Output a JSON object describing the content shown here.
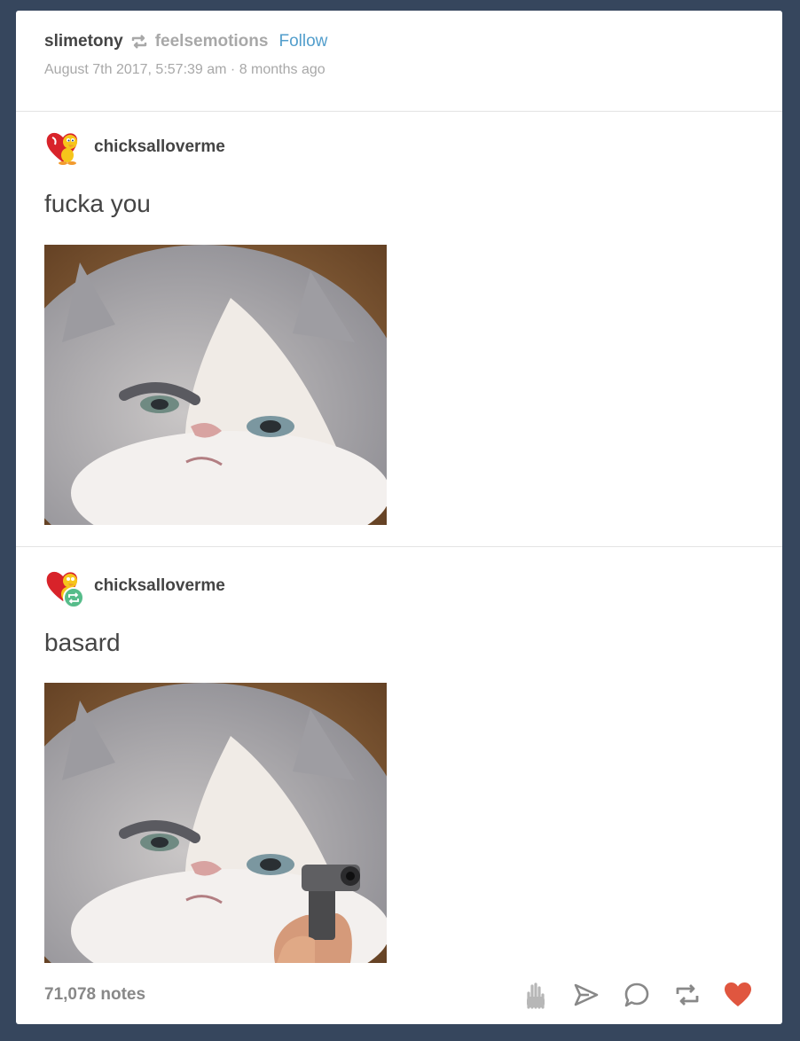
{
  "header": {
    "username": "slimetony",
    "reblog_icon": "reblog-icon",
    "source": "feelsemotions",
    "follow_label": "Follow",
    "timestamp": "August 7th 2017, 5:57:39 am · 8 months ago"
  },
  "entries": [
    {
      "blog": "chicksalloverme",
      "avatar_icon": "heart-tweety-avatar",
      "text": "fucka you",
      "image": "grumpy-kitten-photo"
    },
    {
      "blog": "chicksalloverme",
      "avatar_icon": "heart-tweety-avatar-with-reblog-badge",
      "text": "basard",
      "image": "grumpy-kitten-with-gun-photo"
    }
  ],
  "footer": {
    "notes": "71,078 notes",
    "actions": [
      "hand-icon",
      "share-icon",
      "reply-icon",
      "reblog-icon",
      "like-heart-icon"
    ]
  },
  "colors": {
    "background": "#36465d",
    "link": "#529ecc",
    "like": "#e0563f",
    "reblog_badge": "#56bc8a"
  }
}
